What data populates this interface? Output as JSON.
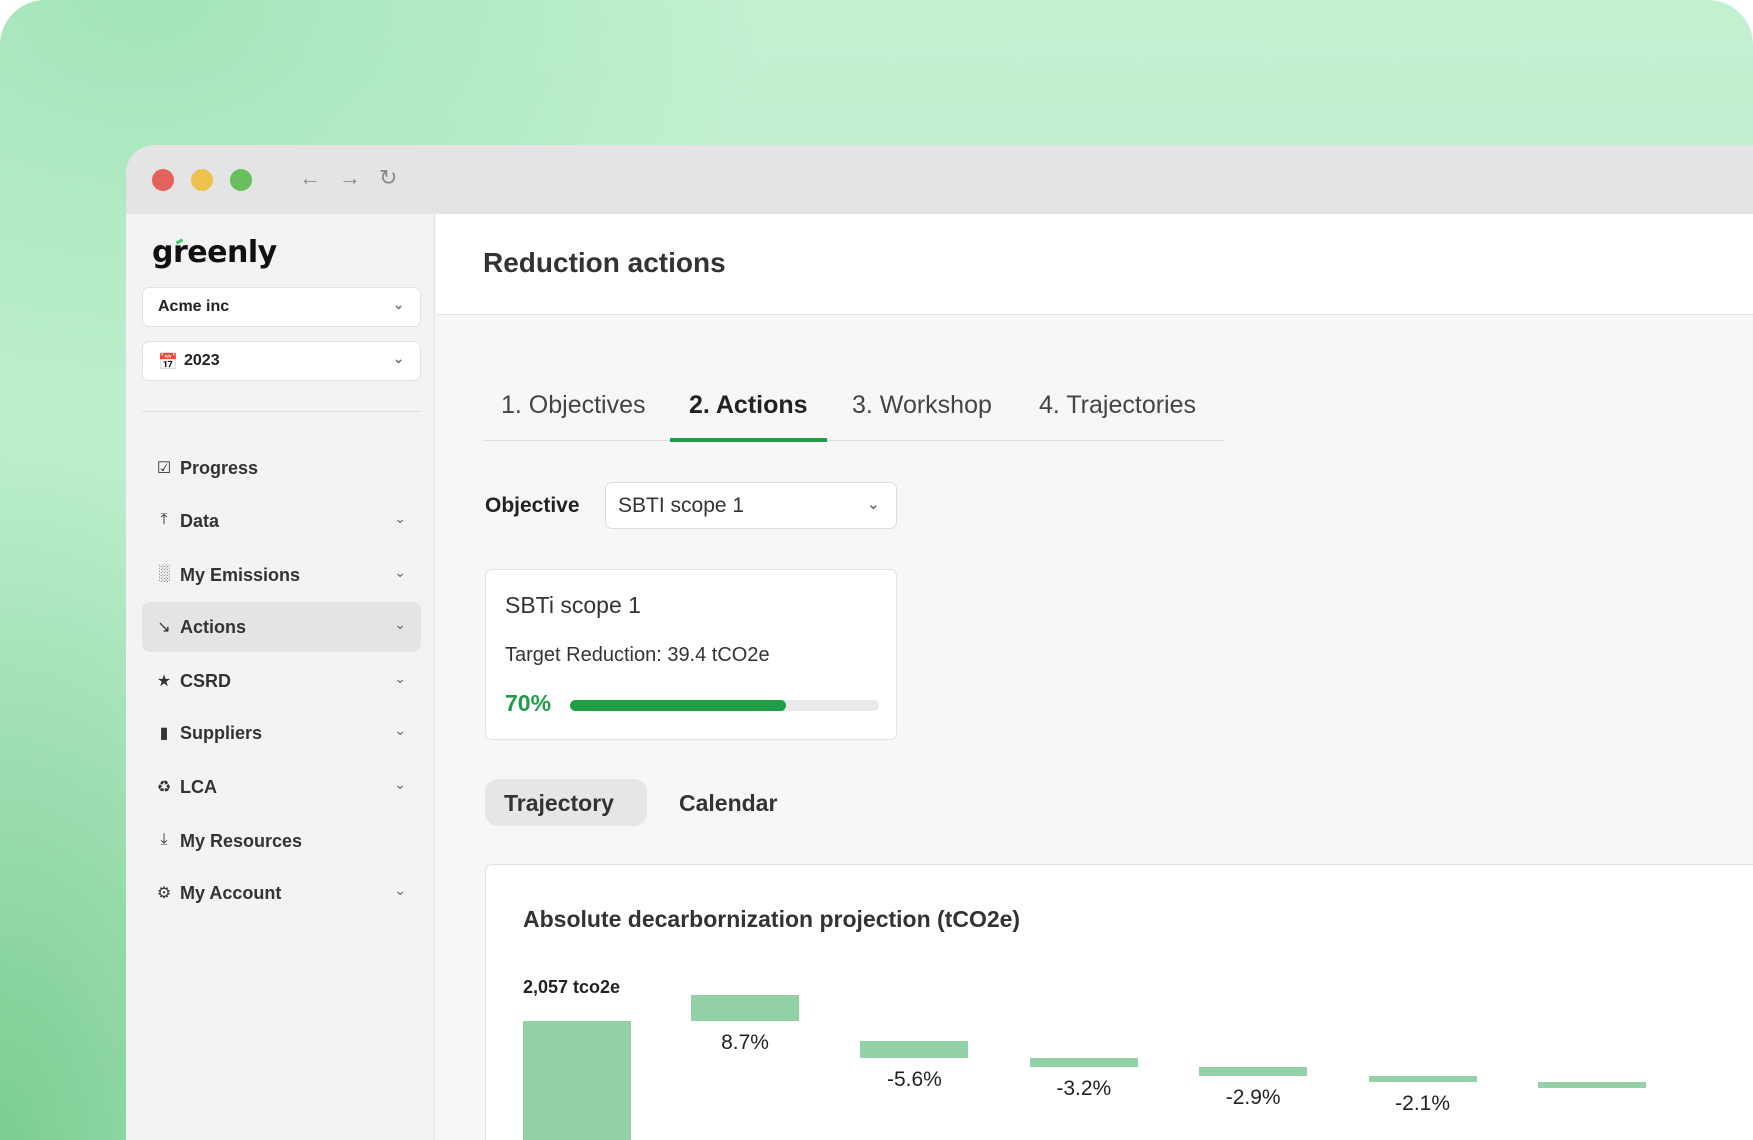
{
  "browser": {
    "back_icon": "←",
    "forward_icon": "→",
    "reload_icon": "↻"
  },
  "sidebar": {
    "logo": "greenly",
    "company_select": "Acme inc",
    "year_select": "2023",
    "items": [
      {
        "label": "Progress",
        "icon": "checkbox-icon",
        "chevron": false
      },
      {
        "label": "Data",
        "icon": "upload-icon",
        "chevron": true
      },
      {
        "label": "My Emissions",
        "icon": "bar-chart-icon",
        "chevron": true
      },
      {
        "label": "Actions",
        "icon": "trend-down-icon",
        "chevron": true,
        "active": true
      },
      {
        "label": "CSRD",
        "icon": "star-icon",
        "chevron": true
      },
      {
        "label": "Suppliers",
        "icon": "folder-icon",
        "chevron": true
      },
      {
        "label": "LCA",
        "icon": "recycle-icon",
        "chevron": true
      },
      {
        "label": "My Resources",
        "icon": "download-icon",
        "chevron": false
      },
      {
        "label": "My Account",
        "icon": "gear-icon",
        "chevron": true
      }
    ]
  },
  "header": {
    "title": "Reduction actions"
  },
  "tabs": [
    "1. Objectives",
    "2. Actions",
    "3. Workshop",
    "4. Trajectories"
  ],
  "objective": {
    "label": "Objective",
    "value": "SBTI scope 1"
  },
  "card": {
    "name": "SBTi scope 1",
    "target": "Target Reduction: 39.4 tCO2e",
    "progress_label": "70%",
    "progress": 0.7
  },
  "view_tabs": {
    "trajectory": "Trajectory",
    "calendar": "Calendar"
  },
  "colors": {
    "accent": "#1e9e47",
    "bar": "#93d1a6"
  },
  "chart_data": {
    "type": "bar",
    "title": "Absolute decarbornization projection (tCO2e)",
    "start_label": "2,057 tco2e",
    "start_value": 2057,
    "steps": [
      {
        "label": "8.7%",
        "value": 8.7
      },
      {
        "label": "-5.6%",
        "value": -5.6
      },
      {
        "label": "-3.2%",
        "value": -3.2
      },
      {
        "label": "-2.9%",
        "value": -2.9
      },
      {
        "label": "-2.1%",
        "value": -2.1
      },
      {
        "label": "",
        "value": -1.9
      }
    ]
  }
}
